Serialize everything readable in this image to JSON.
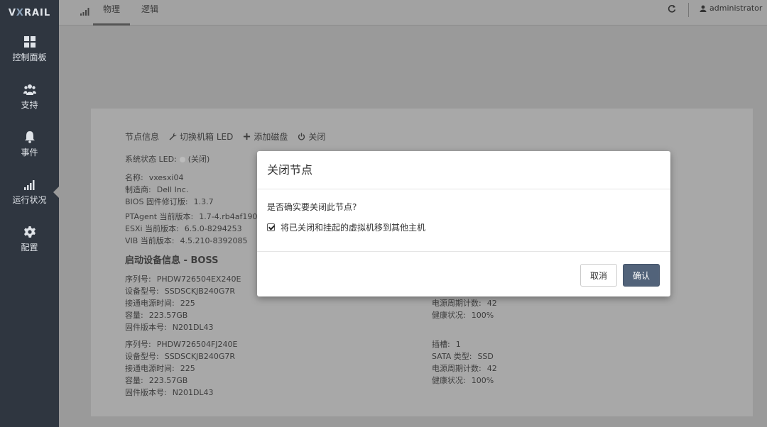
{
  "sidebar": {
    "logo_prefix": "V",
    "logo_x": "X",
    "logo_suffix": "RAIL",
    "items": [
      {
        "label": "控制面板",
        "icon": "dashboard-icon"
      },
      {
        "label": "支持",
        "icon": "users-icon"
      },
      {
        "label": "事件",
        "icon": "bell-icon"
      },
      {
        "label": "运行状况",
        "icon": "signal-icon"
      },
      {
        "label": "配置",
        "icon": "gear-icon"
      }
    ]
  },
  "topbar": {
    "tabs": [
      "物理",
      "逻辑"
    ],
    "active_tab": "物理",
    "user": "administrator"
  },
  "node": {
    "toolbar": {
      "title": "节点信息",
      "toggle_led": "切换机箱 LED",
      "add_disk": "添加磁盘",
      "shutdown": "关闭"
    },
    "system_led_label": "系统状态 LED:",
    "system_led_value": "(关闭)",
    "name_label": "名称:",
    "name": "vxesxi04",
    "vendor_label": "制造商:",
    "vendor": "Dell Inc.",
    "bios_label": "BIOS 固件修订版:",
    "bios": "1.3.7",
    "ptagent_label": "PTAgent 当前版本:",
    "ptagent": "1.7-4.rb4af190",
    "esxi_label": "ESXi 当前版本:",
    "esxi": "6.5.0-8294253",
    "vib_label": "VIB 当前版本:",
    "vib": "4.5.210-8392085",
    "boot_title": "启动设备信息 - BOSS",
    "disks": [
      {
        "serial_label": "序列号:",
        "serial": "PHDW726504EX240E",
        "model_label": "设备型号:",
        "model": "SSDSCKJB240G7R",
        "power_on_label": "接通电源时间:",
        "power_on": "225",
        "capacity_label": "容量:",
        "capacity": "223.57GB",
        "firmware_label": "固件版本号:",
        "firmware": "N201DL43",
        "cycles_label": "电源周期计数:",
        "cycles": "42",
        "health_label": "健康状况:",
        "health": "100%"
      },
      {
        "serial_label": "序列号:",
        "serial": "PHDW726504FJ240E",
        "model_label": "设备型号:",
        "model": "SSDSCKJB240G7R",
        "power_on_label": "接通电源时间:",
        "power_on": "225",
        "capacity_label": "容量:",
        "capacity": "223.57GB",
        "firmware_label": "固件版本号:",
        "firmware": "N201DL43",
        "slot_label": "插槽:",
        "slot": "1",
        "sata_label": "SATA 类型:",
        "sata": "SSD",
        "cycles_label": "电源周期计数:",
        "cycles": "42",
        "health_label": "健康状况:",
        "health": "100%"
      }
    ]
  },
  "modal": {
    "title": "关闭节点",
    "question": "是否确实要关闭此节点?",
    "checkbox_label": "将已关闭和挂起的虚拟机移到其他主机",
    "checkbox_checked": true,
    "cancel": "取消",
    "confirm": "确认"
  },
  "colors": {
    "sidebar_bg": "#2f3640",
    "confirm_button": "#52637a",
    "overlay": "#9a9a9a"
  }
}
